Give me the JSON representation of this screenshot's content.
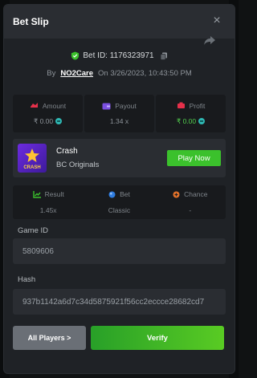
{
  "header": {
    "title": "Bet Slip",
    "close_glyph": "×"
  },
  "bet": {
    "id_text": "Bet ID: 1176323971",
    "by_label": "By",
    "user": "NO2Care",
    "on_text": "On 3/26/2023, 10:43:50 PM"
  },
  "stats": [
    {
      "label": "Amount",
      "value": "₹ 0.00",
      "icon": "money-icon",
      "value_color": "#8e949a"
    },
    {
      "label": "Payout",
      "value": "1.34 x",
      "icon": "wallet-icon",
      "value_color": "#8e949a"
    },
    {
      "label": "Profit",
      "value": "₹ 0.00",
      "icon": "money-icon",
      "value_color": "#52d04e"
    }
  ],
  "game": {
    "name": "Crash",
    "provider": "BC Originals",
    "thumb_text": "CRASH",
    "play_label": "Play Now"
  },
  "details": [
    {
      "label": "Result",
      "value": "1.45x",
      "icon": "chart-icon"
    },
    {
      "label": "Bet",
      "value": "Classic",
      "icon": "drop-icon"
    },
    {
      "label": "Chance",
      "value": "-",
      "icon": "target-icon"
    }
  ],
  "fields": {
    "game_id_label": "Game ID",
    "game_id_value": "5809606",
    "hash_label": "Hash",
    "hash_value": "937b1142a6d7c34d5875921f56cc2eccce28682cd7"
  },
  "actions": {
    "players_label": "All Players >",
    "verify_label": "Verify"
  },
  "colors": {
    "accent_green": "#3bc12c",
    "modal_bg": "#1f2226",
    "header_bg": "#2a2d32"
  }
}
